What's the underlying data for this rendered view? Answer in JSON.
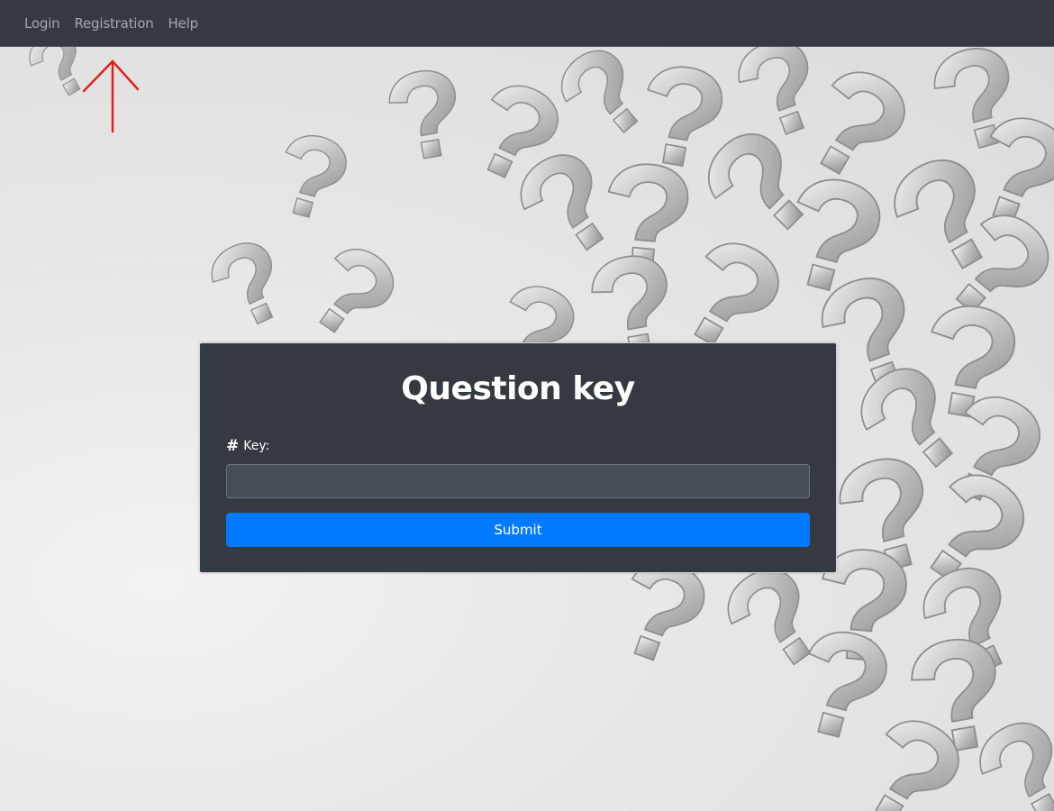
{
  "navbar": {
    "links": [
      {
        "label": "Login"
      },
      {
        "label": "Registration"
      },
      {
        "label": "Help"
      }
    ]
  },
  "form": {
    "title": "Question key",
    "key_label": "Key:",
    "key_icon": "hash-icon",
    "key_value": "",
    "key_placeholder": "",
    "submit_label": "Submit"
  },
  "colors": {
    "navbar": "#343a40",
    "card": "#343a40",
    "input": "#454d55",
    "submit": "#007bff",
    "annotation_arrow": "#e02020"
  }
}
